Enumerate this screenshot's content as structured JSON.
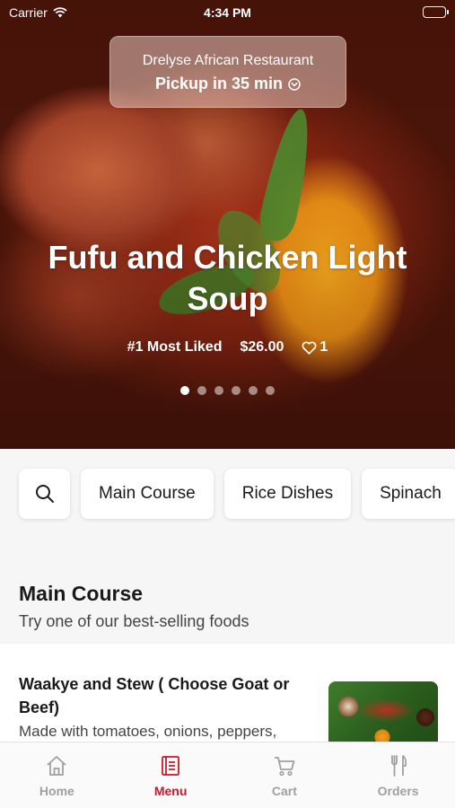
{
  "status_bar": {
    "carrier": "Carrier",
    "time": "4:34 PM"
  },
  "hero": {
    "restaurant_name": "Drelyse African Restaurant",
    "pickup_time": "Pickup in 35 min",
    "dish_title": "Fufu and Chicken Light Soup",
    "rank_label": "#1 Most Liked",
    "price": "$26.00",
    "likes": "1",
    "carousel": {
      "count": 6,
      "active_index": 0
    }
  },
  "categories": {
    "search_icon": "search-icon",
    "items": [
      "Main Course",
      "Rice Dishes",
      "Spinach"
    ]
  },
  "section": {
    "title": "Main Course",
    "subtitle": "Try one of our best-selling foods"
  },
  "menu_items": [
    {
      "name": "Waakye and Stew ( Choose Goat or Beef)",
      "description": "Made with tomatoes, onions, peppers,"
    }
  ],
  "tab_bar": {
    "active_color": "#c8192b",
    "inactive_color": "#a0a0a0",
    "tabs": [
      {
        "label": "Home",
        "icon": "home-icon"
      },
      {
        "label": "Menu",
        "icon": "menu-book-icon"
      },
      {
        "label": "Cart",
        "icon": "cart-icon"
      },
      {
        "label": "Orders",
        "icon": "fork-knife-icon"
      }
    ],
    "active_tab": "Menu"
  }
}
